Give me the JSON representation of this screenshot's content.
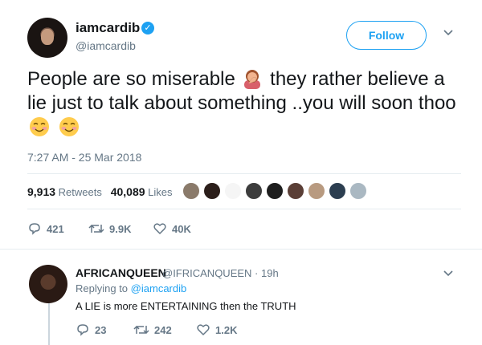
{
  "tweet": {
    "name": "iamcardib",
    "handle": "@iamcardib",
    "follow_label": "Follow",
    "text_part1": "People are so miserable",
    "text_part2": "they rather believe a lie just to talk about something ..you will soon thoo",
    "emoji_1": "facepalm-woman-emoji",
    "emoji_2": "smiling-face-emoji",
    "timestamp": "7:27 AM - 25 Mar 2018",
    "retweets_count": "9,913",
    "retweets_label": "Retweets",
    "likes_count": "40,089",
    "likes_label": "Likes",
    "actions": {
      "replies": "421",
      "retweets": "9.9K",
      "likes": "40K"
    }
  },
  "reply": {
    "name": "AFRICANQUEEN",
    "meta": "@IFRICANQUEEN · 19h",
    "replying_prefix": "Replying to",
    "replying_handle": "@iamcardib",
    "text": "A LIE is more ENTERTAINING then the TRUTH",
    "actions": {
      "replies": "23",
      "retweets": "242",
      "likes": "1.2K"
    }
  },
  "colors": {
    "accent": "#1da1f2",
    "muted": "#657786",
    "text": "#14171a",
    "divider": "#e6ecf0"
  }
}
